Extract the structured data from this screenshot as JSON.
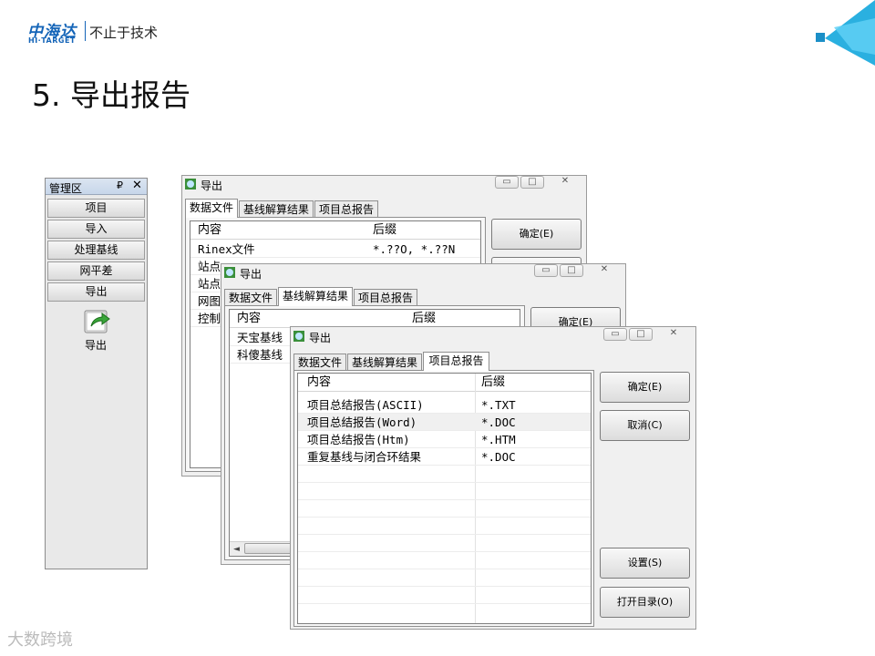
{
  "logo": {
    "brand_cn": "中海达",
    "brand_en": "HI·TARGET",
    "slogan": "不止于技术"
  },
  "slide_title": "5. 导出报告",
  "watermark": "大数跨境",
  "manager": {
    "title": "管理区",
    "pin": "₽",
    "close": "✕",
    "items": [
      {
        "label": "项目"
      },
      {
        "label": "导入"
      },
      {
        "label": "处理基线"
      },
      {
        "label": "网平差"
      },
      {
        "label": "导出"
      }
    ],
    "export_icon_label": "导出"
  },
  "windows": [
    {
      "title": "导出",
      "tabs": [
        "数据文件",
        "基线解算结果",
        "项目总报告"
      ],
      "active_tab": 0,
      "columns": [
        "内容",
        "后缀"
      ],
      "rows": [
        {
          "content": "Rinex文件",
          "suffix": "*.??O, *.??N"
        },
        {
          "content": "站点",
          "suffix": ""
        },
        {
          "content": "站点",
          "suffix": ""
        },
        {
          "content": "网图",
          "suffix": ""
        },
        {
          "content": "控制",
          "suffix": ""
        }
      ],
      "buttons": [
        "确定(E)"
      ]
    },
    {
      "title": "导出",
      "tabs": [
        "数据文件",
        "基线解算结果",
        "项目总报告"
      ],
      "active_tab": 1,
      "columns": [
        "内容",
        "后缀"
      ],
      "rows": [
        {
          "content": "天宝基线",
          "suffix": ""
        },
        {
          "content": "科傻基线",
          "suffix": ""
        }
      ],
      "buttons": [
        "确定(E)"
      ]
    },
    {
      "title": "导出",
      "tabs": [
        "数据文件",
        "基线解算结果",
        "项目总报告"
      ],
      "active_tab": 2,
      "columns": [
        "内容",
        "后缀"
      ],
      "rows": [
        {
          "content": "项目总结报告(ASCII)",
          "suffix": "*.TXT"
        },
        {
          "content": "项目总结报告(Word)",
          "suffix": "*.DOC"
        },
        {
          "content": "项目总结报告(Htm)",
          "suffix": "*.HTM"
        },
        {
          "content": "重复基线与闭合环结果",
          "suffix": "*.DOC"
        }
      ],
      "buttons": [
        "确定(E)",
        "取消(C)",
        "设置(S)",
        "打开目录(O)"
      ]
    }
  ],
  "window_controls": {
    "minimize": "▭",
    "maximize": "□",
    "close": "✕"
  },
  "colors": {
    "brand_blue": "#1565b8",
    "deco_cyan": "#2ab0e0"
  }
}
